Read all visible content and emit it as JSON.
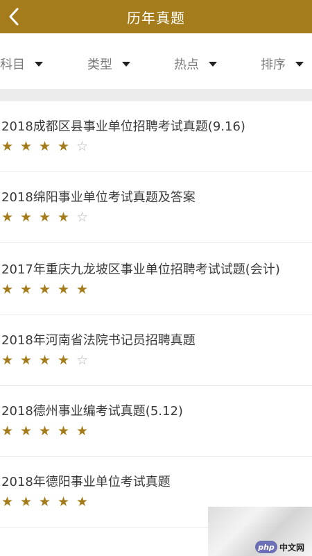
{
  "header": {
    "title": "历年真题",
    "back_icon": "chevron-left-icon"
  },
  "colors": {
    "accent": "#a57c1b",
    "star_filled": "#a57c1b",
    "star_empty": "#b5b5b5"
  },
  "filters": [
    {
      "label": "科目"
    },
    {
      "label": "类型"
    },
    {
      "label": "热点"
    },
    {
      "label": "排序"
    }
  ],
  "list": [
    {
      "title": "2018成都区县事业单位招聘考试真题(9.16)",
      "rating": 4,
      "max": 5
    },
    {
      "title": "2018绵阳事业单位考试真题及答案",
      "rating": 4,
      "max": 5
    },
    {
      "title": "2017年重庆九龙坡区事业单位招聘考试试题(会计)",
      "rating": 5,
      "max": 5
    },
    {
      "title": "2018年河南省法院书记员招聘真题",
      "rating": 4,
      "max": 5
    },
    {
      "title": "2018德州事业编考试真题(5.12)",
      "rating": 5,
      "max": 5
    },
    {
      "title": "2018年德阳事业单位考试真题",
      "rating": 5,
      "max": 5
    }
  ],
  "watermark": {
    "badge": "php",
    "text": "中文网"
  }
}
